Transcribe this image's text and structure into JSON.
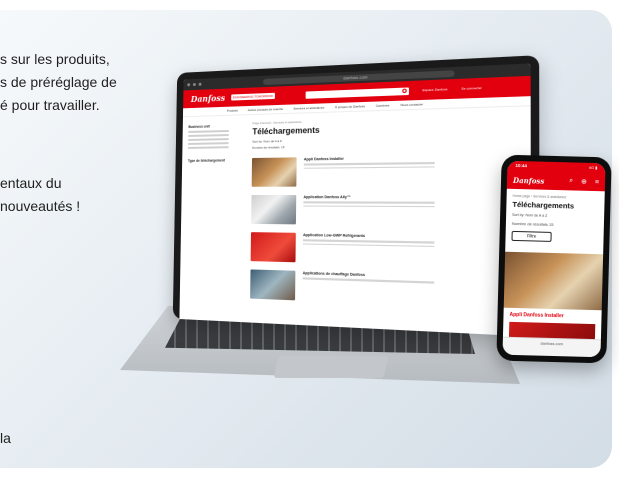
{
  "background_text": [
    "s sur les produits,",
    "s de préréglage de",
    "é pour travailler.",
    "entaux du",
    "nouveautés !",
    "la"
  ],
  "laptop": {
    "url": "danfoss.com",
    "logo": "Danfoss",
    "logo_tag": "ENGINEERING TOMORROW",
    "header_links": [
      "Espace Danfoss",
      "Se connecter"
    ],
    "nav": [
      "Produits",
      "Autres produits de marché",
      "Services et assistance",
      "À propos de Danfoss",
      "Carrières",
      "Nous contacter"
    ],
    "breadcrumb": "Page d'accueil  ›  Services et assistance",
    "title": "Téléchargements",
    "sort": "Sort by:   Nom de A à Z",
    "results": "Nombre de résultats: 15",
    "sidebar_title_1": "Business unit",
    "sidebar_title_2": "Type de téléchargement",
    "results_list": [
      {
        "title": "Appli Danfoss Installer"
      },
      {
        "title": "Application Danfoss Ally™"
      },
      {
        "title": "Application Low-GWP Refrigerants"
      },
      {
        "title": "Applications de chauffage Danfoss"
      }
    ]
  },
  "phone": {
    "time": "10:44",
    "signal": "4G ▮",
    "logo": "Danfoss",
    "breadcrumb": "Home page  ›  Services & assistance",
    "title": "Téléchargements",
    "sort": "Sort by:   Nom de A à Z",
    "results": "Nombre de résultats 15",
    "filter": "Filtre",
    "caption": "Appli Danfoss Installer",
    "bottom_url": "danfoss.com"
  },
  "colors": {
    "brand_red": "#e2000f"
  }
}
